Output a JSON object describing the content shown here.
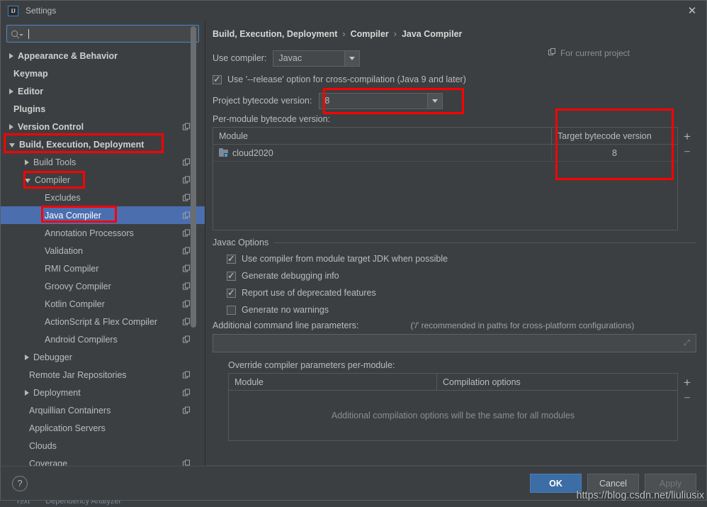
{
  "window": {
    "title": "Settings",
    "logo_text": "IJ",
    "close_label": "✕"
  },
  "search": {
    "value": "",
    "placeholder": ""
  },
  "sidebar": {
    "items": [
      {
        "label": "Appearance & Behavior",
        "arrow": "collapsed",
        "indent": 0,
        "bold": true,
        "copy": false,
        "selected": false
      },
      {
        "label": "Keymap",
        "arrow": "none",
        "indent": 0,
        "bold": true,
        "copy": false,
        "selected": false
      },
      {
        "label": "Editor",
        "arrow": "collapsed",
        "indent": 0,
        "bold": true,
        "copy": false,
        "selected": false
      },
      {
        "label": "Plugins",
        "arrow": "none",
        "indent": 0,
        "bold": true,
        "copy": false,
        "selected": false
      },
      {
        "label": "Version Control",
        "arrow": "collapsed",
        "indent": 0,
        "bold": true,
        "copy": true,
        "selected": false
      },
      {
        "label": "Build, Execution, Deployment",
        "arrow": "open",
        "indent": 0,
        "bold": true,
        "copy": false,
        "selected": false
      },
      {
        "label": "Build Tools",
        "arrow": "collapsed",
        "indent": 1,
        "bold": false,
        "copy": true,
        "selected": false
      },
      {
        "label": "Compiler",
        "arrow": "open",
        "indent": 1,
        "bold": false,
        "copy": true,
        "selected": false
      },
      {
        "label": "Excludes",
        "arrow": "none",
        "indent": 2,
        "bold": false,
        "copy": true,
        "selected": false
      },
      {
        "label": "Java Compiler",
        "arrow": "none",
        "indent": 2,
        "bold": false,
        "copy": true,
        "selected": true
      },
      {
        "label": "Annotation Processors",
        "arrow": "none",
        "indent": 2,
        "bold": false,
        "copy": true,
        "selected": false
      },
      {
        "label": "Validation",
        "arrow": "none",
        "indent": 2,
        "bold": false,
        "copy": true,
        "selected": false
      },
      {
        "label": "RMI Compiler",
        "arrow": "none",
        "indent": 2,
        "bold": false,
        "copy": true,
        "selected": false
      },
      {
        "label": "Groovy Compiler",
        "arrow": "none",
        "indent": 2,
        "bold": false,
        "copy": true,
        "selected": false
      },
      {
        "label": "Kotlin Compiler",
        "arrow": "none",
        "indent": 2,
        "bold": false,
        "copy": true,
        "selected": false
      },
      {
        "label": "ActionScript & Flex Compiler",
        "arrow": "none",
        "indent": 2,
        "bold": false,
        "copy": true,
        "selected": false
      },
      {
        "label": "Android Compilers",
        "arrow": "none",
        "indent": 2,
        "bold": false,
        "copy": true,
        "selected": false
      },
      {
        "label": "Debugger",
        "arrow": "collapsed",
        "indent": 1,
        "bold": false,
        "copy": false,
        "selected": false
      },
      {
        "label": "Remote Jar Repositories",
        "arrow": "none",
        "indent": 1,
        "bold": false,
        "copy": true,
        "selected": false
      },
      {
        "label": "Deployment",
        "arrow": "collapsed",
        "indent": 1,
        "bold": false,
        "copy": true,
        "selected": false
      },
      {
        "label": "Arquillian Containers",
        "arrow": "none",
        "indent": 1,
        "bold": false,
        "copy": true,
        "selected": false
      },
      {
        "label": "Application Servers",
        "arrow": "none",
        "indent": 1,
        "bold": false,
        "copy": false,
        "selected": false
      },
      {
        "label": "Clouds",
        "arrow": "none",
        "indent": 1,
        "bold": false,
        "copy": false,
        "selected": false
      },
      {
        "label": "Coverage",
        "arrow": "none",
        "indent": 1,
        "bold": false,
        "copy": true,
        "selected": false
      }
    ]
  },
  "breadcrumb": {
    "part1": "Build, Execution, Deployment",
    "sep1": "›",
    "part2": "Compiler",
    "sep2": "›",
    "part3": "Java Compiler",
    "scope_label": "For current project"
  },
  "main": {
    "use_compiler_label": "Use compiler:",
    "use_compiler_value": "Javac",
    "release_option_label": "Use '--release' option for cross-compilation (Java 9 and later)",
    "release_option_checked": true,
    "project_bytecode_label": "Project bytecode version:",
    "project_bytecode_value": "8",
    "per_module_label": "Per-module bytecode version:",
    "module_table": {
      "columns": [
        "Module",
        "Target bytecode version"
      ],
      "rows": [
        {
          "module": "cloud2020",
          "target": "8"
        }
      ],
      "add_label": "+",
      "remove_label": "−"
    },
    "javac_group_title": "Javac Options",
    "javac_options": [
      {
        "label": "Use compiler from module target JDK when possible",
        "checked": true
      },
      {
        "label": "Generate debugging info",
        "checked": true
      },
      {
        "label": "Report use of deprecated features",
        "checked": true
      },
      {
        "label": "Generate no warnings",
        "checked": false
      }
    ],
    "additional_params_label": "Additional command line parameters:",
    "additional_params_hint": "('/' recommended in paths for cross-platform configurations)",
    "additional_params_value": "",
    "expand_icon_label": "⤢",
    "override_label": "Override compiler parameters per-module:",
    "override_table": {
      "columns": [
        "Module",
        "Compilation options"
      ],
      "empty_text": "Additional compilation options will be the same for all modules",
      "add_label": "+",
      "remove_label": "−"
    }
  },
  "footer": {
    "help_label": "?",
    "ok_label": "OK",
    "cancel_label": "Cancel",
    "apply_label": "Apply"
  },
  "watermark": "https://blog.csdn.net/liuliusix",
  "background": {
    "tab1": "Text",
    "tab2": "Dependency Analyzer"
  },
  "colors": {
    "annotation_red": "#ff0000",
    "selection_blue": "#4b6eaf",
    "primary_button": "#3c6ea5",
    "dialog_bg": "#3c3f41"
  }
}
